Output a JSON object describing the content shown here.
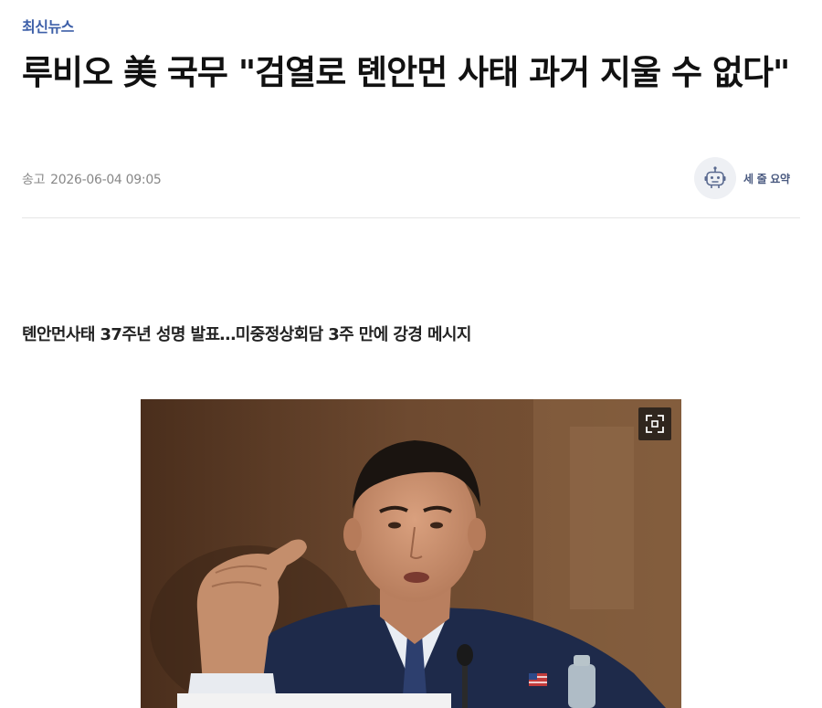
{
  "section": {
    "label": "최신뉴스"
  },
  "article": {
    "headline": "루비오 美 국무 \"검열로 톈안먼 사태 과거 지울 수 없다\"",
    "meta": {
      "label": "송고",
      "datetime": "2026-06-04 09:05"
    },
    "summary_button": {
      "label": "세 줄 요약",
      "icon": "robot-icon"
    },
    "subtitle": "톈안먼사태 37주년 성명 발표…미중정상회담 3주 만에 강경 메시지",
    "photo": {
      "expand_icon": "expand-icon"
    }
  },
  "colors": {
    "accent": "#3d5fa8",
    "meta_text": "#888888",
    "summary_text": "#4a5a80",
    "divider": "#e5e5e5"
  }
}
